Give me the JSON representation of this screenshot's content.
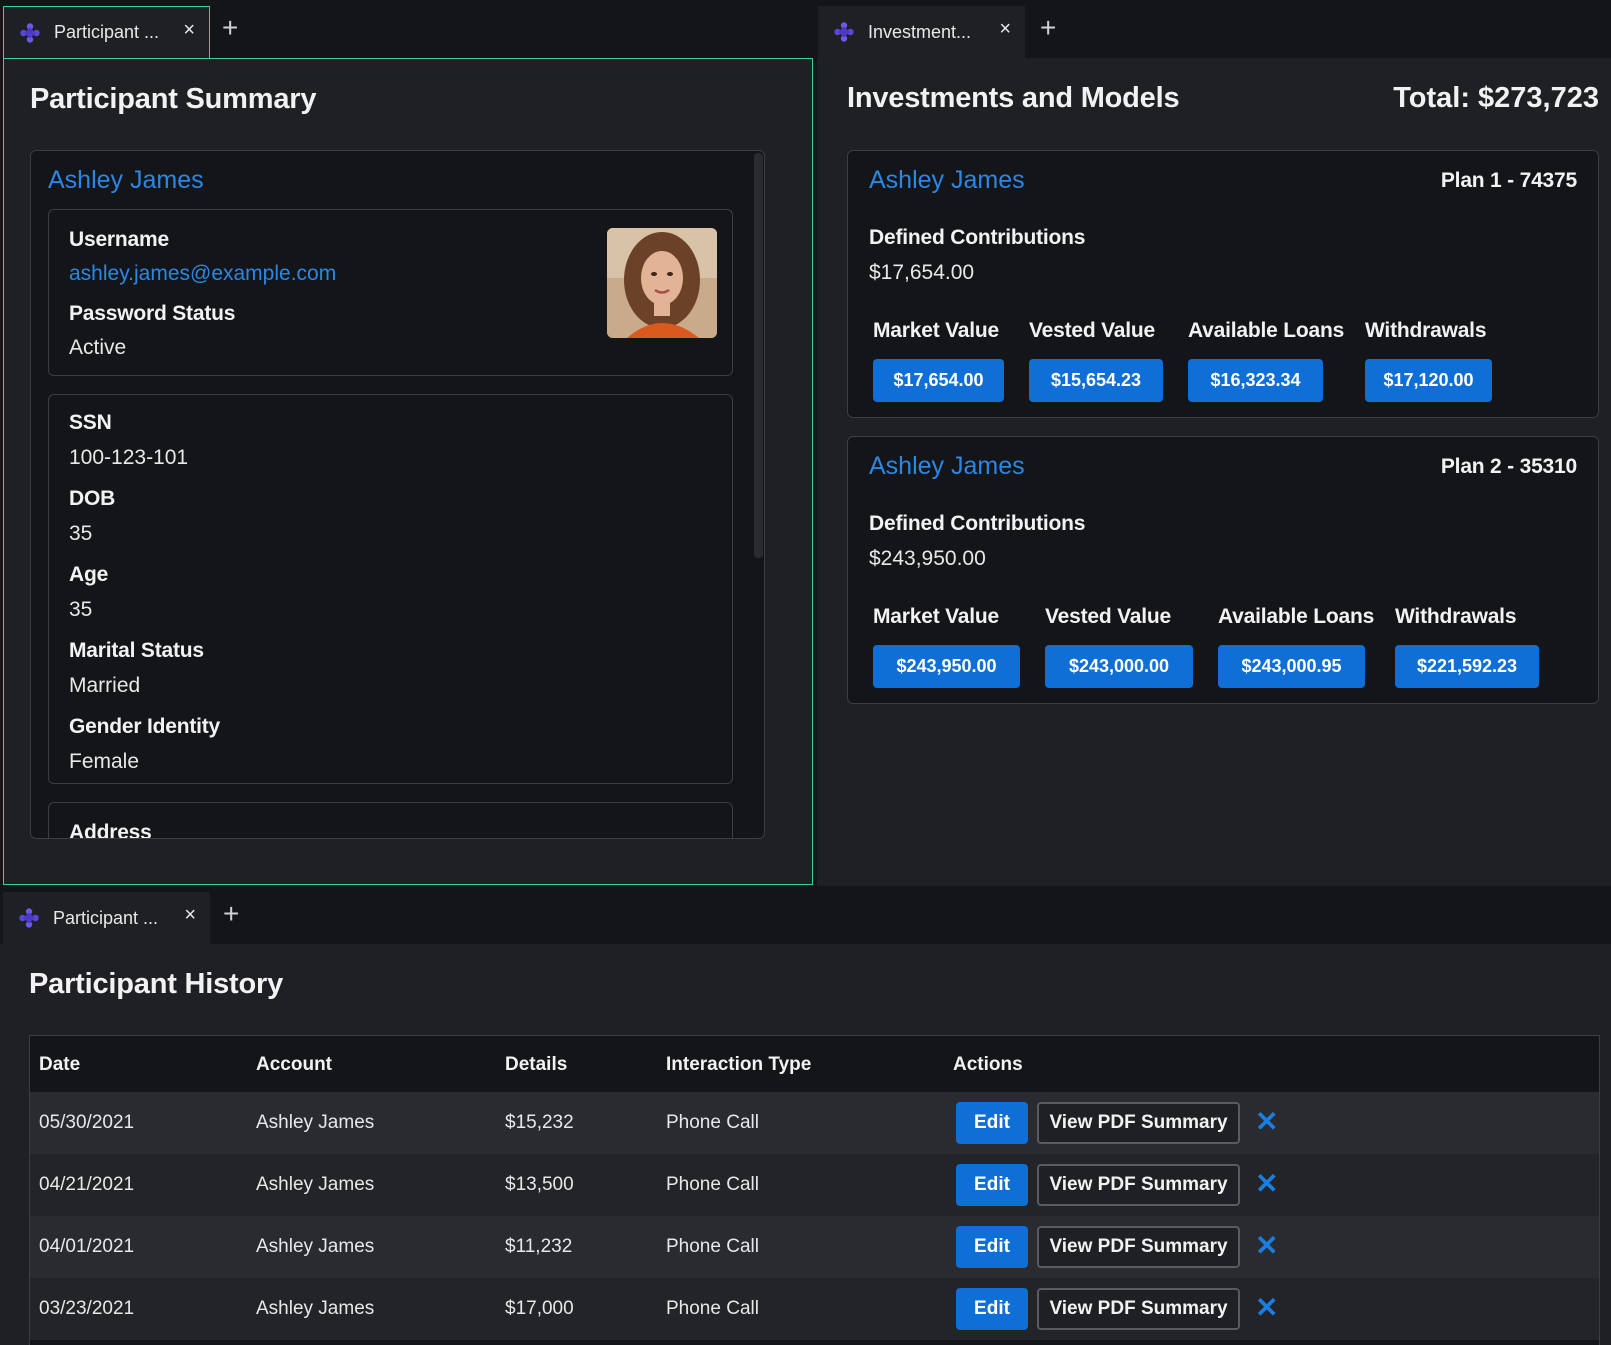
{
  "tabs": {
    "summary": {
      "label": "Participant ...",
      "close": "×",
      "add": "+"
    },
    "investments": {
      "label": "Investment...",
      "close": "×",
      "add": "+"
    },
    "history": {
      "label": "Participant ...",
      "close": "×",
      "add": "+"
    }
  },
  "summary": {
    "title": "Participant Summary",
    "name": "Ashley James",
    "username_label": "Username",
    "username": "ashley.james@example.com",
    "password_label": "Password Status",
    "password_status": "Active",
    "ssn_label": "SSN",
    "ssn": "100-123-101",
    "dob_label": "DOB",
    "dob": "35",
    "age_label": "Age",
    "age": "35",
    "marital_label": "Marital Status",
    "marital": "Married",
    "gender_label": "Gender Identity",
    "gender": "Female",
    "address_label": "Address"
  },
  "investments": {
    "title": "Investments and Models",
    "total": "Total: $273,723",
    "plans": [
      {
        "name": "Ashley James",
        "plan": "Plan 1 - 74375",
        "dc_label": "Defined Contributions",
        "dc_value": "$17,654.00",
        "metrics": [
          {
            "label": "Market Value",
            "value": "$17,654.00"
          },
          {
            "label": "Vested Value",
            "value": "$15,654.23"
          },
          {
            "label": "Available Loans",
            "value": "$16,323.34"
          },
          {
            "label": "Withdrawals",
            "value": "$17,120.00"
          }
        ]
      },
      {
        "name": "Ashley James",
        "plan": "Plan 2 - 35310",
        "dc_label": "Defined Contributions",
        "dc_value": "$243,950.00",
        "metrics": [
          {
            "label": "Market Value",
            "value": "$243,950.00"
          },
          {
            "label": "Vested Value",
            "value": "$243,000.00"
          },
          {
            "label": "Available Loans",
            "value": "$243,000.95"
          },
          {
            "label": "Withdrawals",
            "value": "$221,592.23"
          }
        ]
      }
    ]
  },
  "history": {
    "title": "Participant History",
    "columns": [
      "Date",
      "Account",
      "Details",
      "Interaction Type",
      "Actions"
    ],
    "edit_label": "Edit",
    "pdf_label": "View PDF Summary",
    "delete_glyph": "✕",
    "rows": [
      {
        "date": "05/30/2021",
        "account": "Ashley James",
        "details": "$15,232",
        "type": "Phone Call"
      },
      {
        "date": "04/21/2021",
        "account": "Ashley James",
        "details": "$13,500",
        "type": "Phone Call"
      },
      {
        "date": "04/01/2021",
        "account": "Ashley James",
        "details": "$11,232",
        "type": "Phone Call"
      },
      {
        "date": "03/23/2021",
        "account": "Ashley James",
        "details": "$17,000",
        "type": "Phone Call"
      }
    ]
  },
  "colors": {
    "accent": "#0f6fd6",
    "link": "#2b87e6",
    "focus_border": "#3fcf9a",
    "danger_x": "#1a7ee0"
  }
}
